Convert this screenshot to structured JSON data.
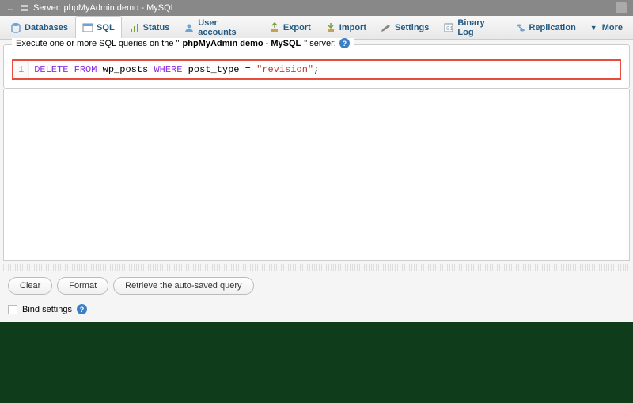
{
  "breadcrumb": {
    "prefix": "Server:",
    "server": "phpMyAdmin demo - MySQL"
  },
  "tabs": [
    {
      "id": "databases",
      "label": "Databases",
      "icon": "database-icon"
    },
    {
      "id": "sql",
      "label": "SQL",
      "icon": "sql-icon",
      "active": true
    },
    {
      "id": "status",
      "label": "Status",
      "icon": "status-icon"
    },
    {
      "id": "users",
      "label": "User accounts",
      "icon": "users-icon"
    },
    {
      "id": "export",
      "label": "Export",
      "icon": "export-icon"
    },
    {
      "id": "import",
      "label": "Import",
      "icon": "import-icon"
    },
    {
      "id": "settings",
      "label": "Settings",
      "icon": "settings-icon"
    },
    {
      "id": "binlog",
      "label": "Binary Log",
      "icon": "binlog-icon"
    },
    {
      "id": "replication",
      "label": "Replication",
      "icon": "replication-icon"
    },
    {
      "id": "more",
      "label": "More",
      "icon": "more-icon"
    }
  ],
  "fieldset": {
    "legend_prefix": "Execute one or more SQL queries on the \"",
    "legend_server": "phpMyAdmin demo - MySQL",
    "legend_suffix": "\" server:"
  },
  "sql": {
    "line_number": "1",
    "kw1": "DELETE",
    "kw2": "FROM",
    "tbl": " wp_posts ",
    "kw3": "WHERE",
    "col": " post_type = ",
    "str": "\"revision\"",
    "end": ";"
  },
  "buttons": {
    "clear": "Clear",
    "format": "Format",
    "retrieve": "Retrieve the auto-saved query"
  },
  "bind": {
    "label": "Bind settings"
  }
}
